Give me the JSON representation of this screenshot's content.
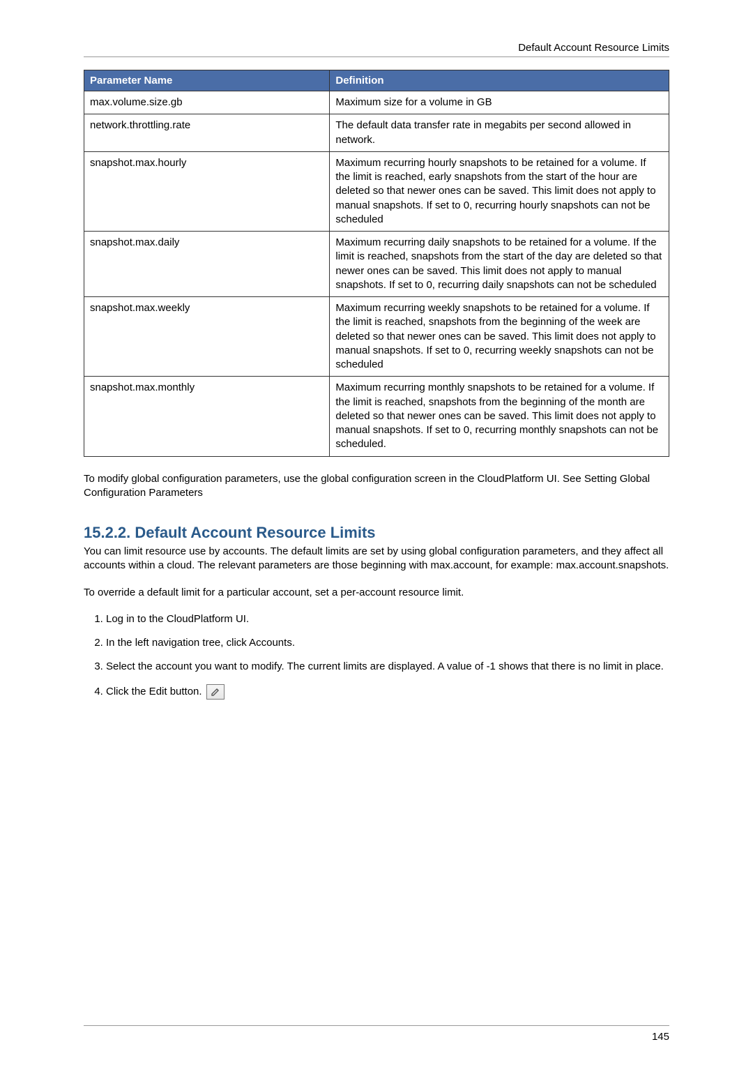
{
  "header": {
    "running_title": "Default Account Resource Limits"
  },
  "table": {
    "headers": {
      "param": "Parameter Name",
      "def": "Definition"
    },
    "rows": [
      {
        "param": "max.volume.size.gb",
        "def": "Maximum size for a volume in GB"
      },
      {
        "param": "network.throttling.rate",
        "def": "The default data transfer rate in megabits per second allowed in network."
      },
      {
        "param": "snapshot.max.hourly",
        "def": "Maximum recurring hourly snapshots to be retained for a volume. If the limit is reached, early snapshots from the start of the hour are deleted so that newer ones can be saved. This limit does not apply to manual snapshots. If set to 0, recurring hourly snapshots can not be scheduled"
      },
      {
        "param": "snapshot.max.daily",
        "def": "Maximum recurring daily snapshots to be retained for a volume. If the limit is reached, snapshots from the start of the day are deleted so that newer ones can be saved. This limit does not apply to manual snapshots. If set to 0, recurring daily snapshots can not be scheduled"
      },
      {
        "param": "snapshot.max.weekly",
        "def": "Maximum recurring weekly snapshots to be retained for a volume. If the limit is reached, snapshots from the beginning of the week are deleted so that newer ones can be saved. This limit does not apply to manual snapshots. If set to 0, recurring weekly snapshots can not be scheduled"
      },
      {
        "param": "snapshot.max.monthly",
        "def": "Maximum recurring monthly snapshots to be retained for a volume. If the limit is reached, snapshots from the beginning of the month are deleted so that newer ones can be saved. This limit does not apply to manual snapshots. If set to 0, recurring monthly snapshots can not be scheduled."
      }
    ]
  },
  "after_table_para": "To modify global configuration parameters, use the global configuration screen in the CloudPlatform UI. See Setting Global Configuration Parameters",
  "section": {
    "heading": "15.2.2. Default Account Resource Limits",
    "intro": "You can limit resource use by accounts. The default limits are set by using global configuration parameters, and they affect all accounts within a cloud. The relevant parameters are those beginning with max.account, for example: max.account.snapshots.",
    "override": "To override a default limit for a particular account, set a per-account resource limit.",
    "steps": {
      "1": "Log in to the CloudPlatform UI.",
      "2": "In the left navigation tree, click Accounts.",
      "3": "Select the account you want to modify. The current limits are displayed. A value of -1 shows that there is no limit in place.",
      "4": "Click the Edit button."
    }
  },
  "page_number": "145"
}
